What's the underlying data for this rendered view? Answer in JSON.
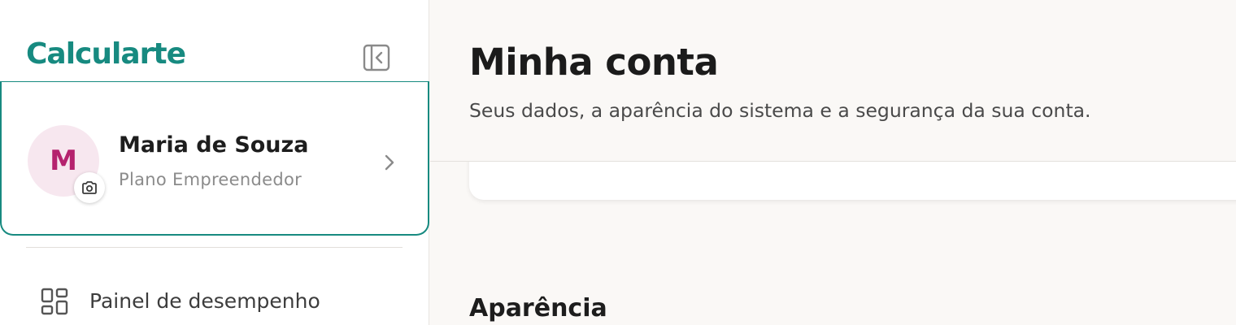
{
  "sidebar": {
    "brand": "Calcularte",
    "profile": {
      "initial": "M",
      "name": "Maria de Souza",
      "plan": "Plano Empreendedor"
    },
    "nav": [
      {
        "label": "Painel de desempenho",
        "icon": "dashboard-grid-icon"
      }
    ]
  },
  "main": {
    "title": "Minha conta",
    "subtitle": "Seus dados, a aparência do sistema e a segurança da sua conta.",
    "section_appearance": "Aparência"
  },
  "colors": {
    "brand": "#178a80",
    "avatar_bg": "#f7e7ef",
    "avatar_text": "#b5226e"
  }
}
